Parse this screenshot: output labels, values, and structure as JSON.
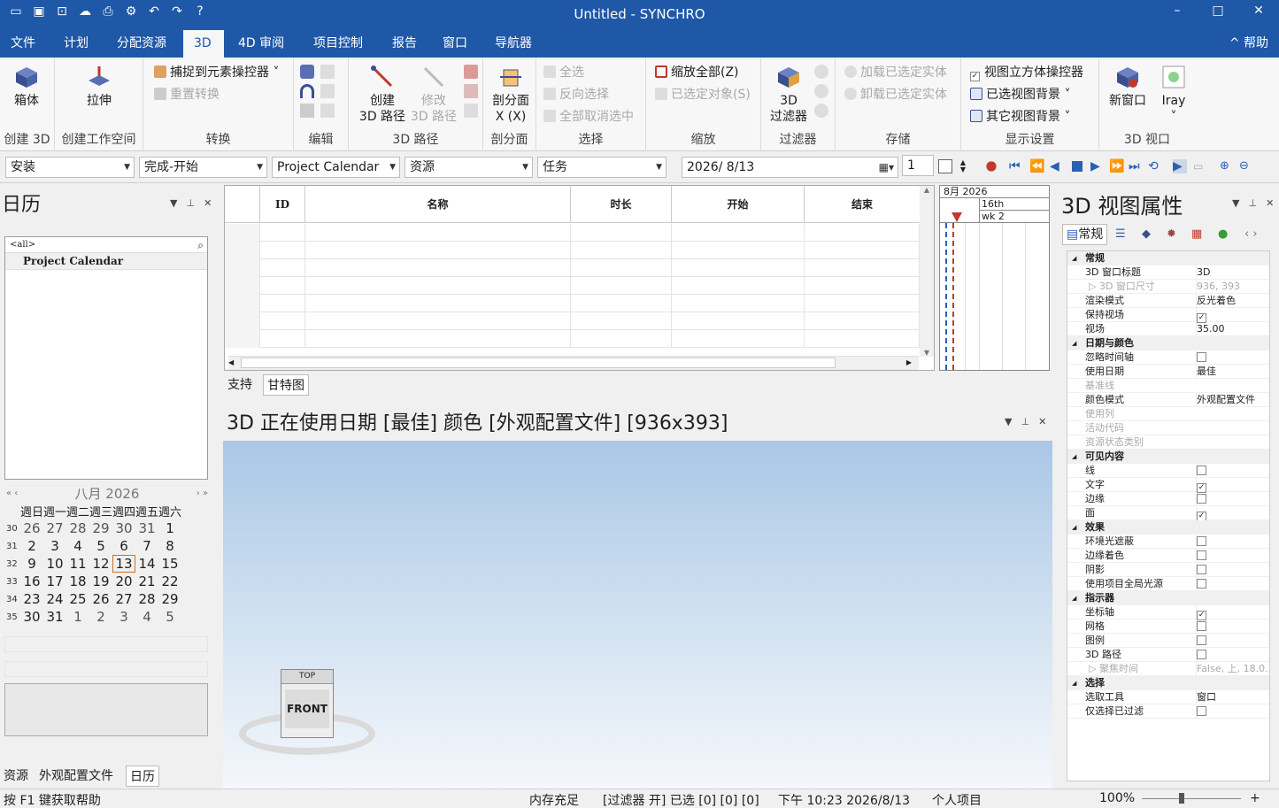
{
  "window": {
    "title": "Untitled - SYNCHRO",
    "minimize": "–",
    "maximize": "□",
    "close": "✕"
  },
  "menu": {
    "items": [
      "文件",
      "计划",
      "分配资源",
      "3D",
      "4D 审阅",
      "项目控制",
      "报告",
      "窗口",
      "导航器"
    ],
    "active": "3D",
    "help": "帮助"
  },
  "ribbon": {
    "create3d": {
      "box": "箱体",
      "group": "创建 3D"
    },
    "workspace": {
      "extrude": "拉伸",
      "group": "创建工作空间"
    },
    "transform": {
      "snap": "捕捉到元素操控器",
      "reset": "重置转换",
      "group": "转换"
    },
    "edit": {
      "group": "编辑"
    },
    "path": {
      "create": "创建",
      "create2": "3D 路径",
      "modify": "修改",
      "modify2": "3D 路径",
      "group": "3D 路径"
    },
    "section": {
      "label": "剖分面",
      "label2": "X (X)",
      "group": "剖分面"
    },
    "select": {
      "all": "全选",
      "invert": "反向选择",
      "none": "全部取消选中",
      "group": "选择"
    },
    "zoom": {
      "all": "缩放全部(Z)",
      "selected": "已选定对象(S)",
      "group": "缩放"
    },
    "filter": {
      "label": "3D",
      "label2": "过滤器",
      "group": "过滤器"
    },
    "store": {
      "load": "加载已选定实体",
      "unload": "卸载已选定实体",
      "group": "存储"
    },
    "display": {
      "cube": "视图立方体操控器",
      "selbg": "已选视图背景",
      "otherbg": "其它视图背景",
      "group": "显示设置"
    },
    "view3d": {
      "newwin": "新窗口",
      "iray": "Iray",
      "group": "3D 视口"
    }
  },
  "toolbar": {
    "c1": "安装",
    "c2": "完成-开始",
    "c3": "Project Calendar",
    "c4": "资源",
    "c5": "任务",
    "date": "2026/  8/13",
    "spin": "1"
  },
  "calendar": {
    "title": "日历",
    "filter": "<all>",
    "item": "Project Calendar",
    "month": "八月 2026",
    "dows": [
      "週日",
      "週一",
      "週二",
      "週三",
      "週四",
      "週五",
      "週六"
    ],
    "weeks": [
      {
        "wk": "30",
        "days": [
          "26",
          "27",
          "28",
          "29",
          "30",
          "31",
          "1"
        ]
      },
      {
        "wk": "31",
        "days": [
          "2",
          "3",
          "4",
          "5",
          "6",
          "7",
          "8"
        ]
      },
      {
        "wk": "32",
        "days": [
          "9",
          "10",
          "11",
          "12",
          "13",
          "14",
          "15"
        ]
      },
      {
        "wk": "33",
        "days": [
          "16",
          "17",
          "18",
          "19",
          "20",
          "21",
          "22"
        ]
      },
      {
        "wk": "34",
        "days": [
          "23",
          "24",
          "25",
          "26",
          "27",
          "28",
          "29"
        ]
      },
      {
        "wk": "35",
        "days": [
          "30",
          "31",
          "1",
          "2",
          "3",
          "4",
          "5"
        ]
      }
    ],
    "tabs": [
      "资源",
      "外观配置文件",
      "日历"
    ]
  },
  "grid": {
    "cols": [
      "ID",
      "名称",
      "时长",
      "开始",
      "结束"
    ],
    "tabs": [
      "支持",
      "甘特图"
    ]
  },
  "gantt": {
    "month": "8月 2026",
    "day": "16th",
    "week": "wk 2"
  },
  "view3d": {
    "title": "3D 正在使用日期 [最佳] 颜色 [外观配置文件]  [936x393]",
    "cube_top": "TOP",
    "cube_front": "FRONT"
  },
  "props": {
    "title": "3D 视图属性",
    "tab": "常规",
    "rows": [
      {
        "t": "cat",
        "n": "常规"
      },
      {
        "n": "3D 窗口标题",
        "v": "3D"
      },
      {
        "n": "3D 窗口尺寸",
        "v": "936, 393",
        "d": true,
        "sub": true
      },
      {
        "n": "渲染模式",
        "v": "反光着色"
      },
      {
        "n": "保持视场",
        "cb": true
      },
      {
        "n": "视场",
        "v": "35.00"
      },
      {
        "t": "cat",
        "n": "日期与颜色"
      },
      {
        "n": "忽略时间轴",
        "cb": false
      },
      {
        "n": "使用日期",
        "v": "最佳"
      },
      {
        "n": "基准线",
        "d": true
      },
      {
        "n": "颜色模式",
        "v": "外观配置文件"
      },
      {
        "n": "使用列",
        "d": true
      },
      {
        "n": "活动代码",
        "d": true
      },
      {
        "n": "资源状态类别",
        "d": true
      },
      {
        "t": "cat",
        "n": "可见内容"
      },
      {
        "n": "线",
        "cb": false
      },
      {
        "n": "文字",
        "cb": true
      },
      {
        "n": "边缘",
        "cb": false
      },
      {
        "n": "面",
        "cb": true
      },
      {
        "t": "cat",
        "n": "效果"
      },
      {
        "n": "环境光遮蔽",
        "cb": false
      },
      {
        "n": "边缘着色",
        "cb": false
      },
      {
        "n": "阴影",
        "cb": false
      },
      {
        "n": "使用项目全局光源",
        "cb": false
      },
      {
        "t": "cat",
        "n": "指示器"
      },
      {
        "n": "坐标轴",
        "cb": true
      },
      {
        "n": "网格",
        "cb": false
      },
      {
        "n": "图例",
        "cb": false
      },
      {
        "n": "3D 路径",
        "cb": false
      },
      {
        "n": "聚焦时间",
        "v": "False, 上, 18.0...",
        "d": true,
        "sub": true
      },
      {
        "t": "cat",
        "n": "选择"
      },
      {
        "n": "选取工具",
        "v": "窗口"
      },
      {
        "n": "仅选择已过滤",
        "cb": false
      }
    ]
  },
  "status": {
    "help": "按 F1 键获取帮助",
    "mem": "内存充足",
    "filter": "[过滤器 开] 已选 [0] [0] [0]",
    "time": "下午 10:23 2026/8/13",
    "proj": "个人项目",
    "zoom": "100%"
  }
}
